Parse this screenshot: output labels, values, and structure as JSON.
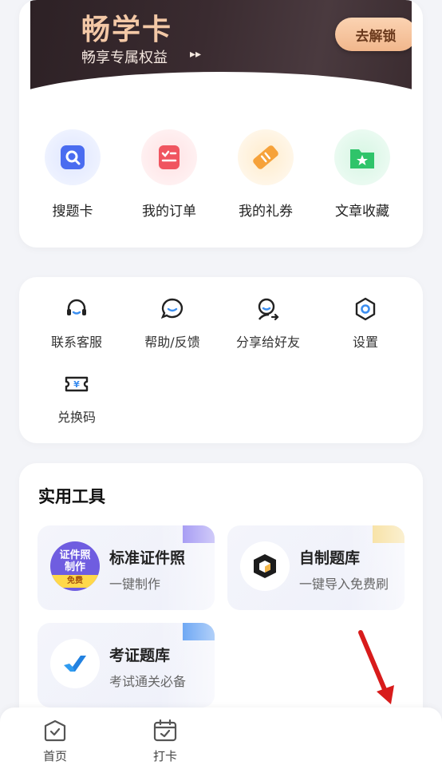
{
  "vip": {
    "title": "畅学卡",
    "subtitle": "畅享专属权益",
    "unlock_label": "去解锁"
  },
  "quick": [
    {
      "label": "搜题卡",
      "icon": "search-card-icon",
      "color": "#4a6cf0"
    },
    {
      "label": "我的订单",
      "icon": "order-icon",
      "color": "#f05560"
    },
    {
      "label": "我的礼券",
      "icon": "coupon-icon",
      "color": "#f6a23a"
    },
    {
      "label": "文章收藏",
      "icon": "favorite-folder-icon",
      "color": "#2fc46a"
    }
  ],
  "services": [
    {
      "label": "联系客服",
      "icon": "headset-icon"
    },
    {
      "label": "帮助/反馈",
      "icon": "chat-bubble-icon"
    },
    {
      "label": "分享给好友",
      "icon": "share-user-icon"
    },
    {
      "label": "设置",
      "icon": "settings-icon"
    },
    {
      "label": "兑换码",
      "icon": "redeem-ticket-icon"
    }
  ],
  "tools": {
    "title": "实用工具",
    "items": [
      {
        "title": "标准证件照",
        "sub": "一键制作",
        "badge_top": "证件照",
        "badge_mid": "制作",
        "badge_tag": "免费",
        "accent": "#8a7cf0"
      },
      {
        "title": "自制题库",
        "sub": "一键导入免费刷",
        "accent": "#f5c96a"
      },
      {
        "title": "考证题库",
        "sub": "考试通关必备",
        "accent": "#3d8af0"
      }
    ]
  },
  "nav": [
    {
      "label": "首页",
      "icon": "home-icon"
    },
    {
      "label": "打卡",
      "icon": "calendar-check-icon"
    }
  ]
}
